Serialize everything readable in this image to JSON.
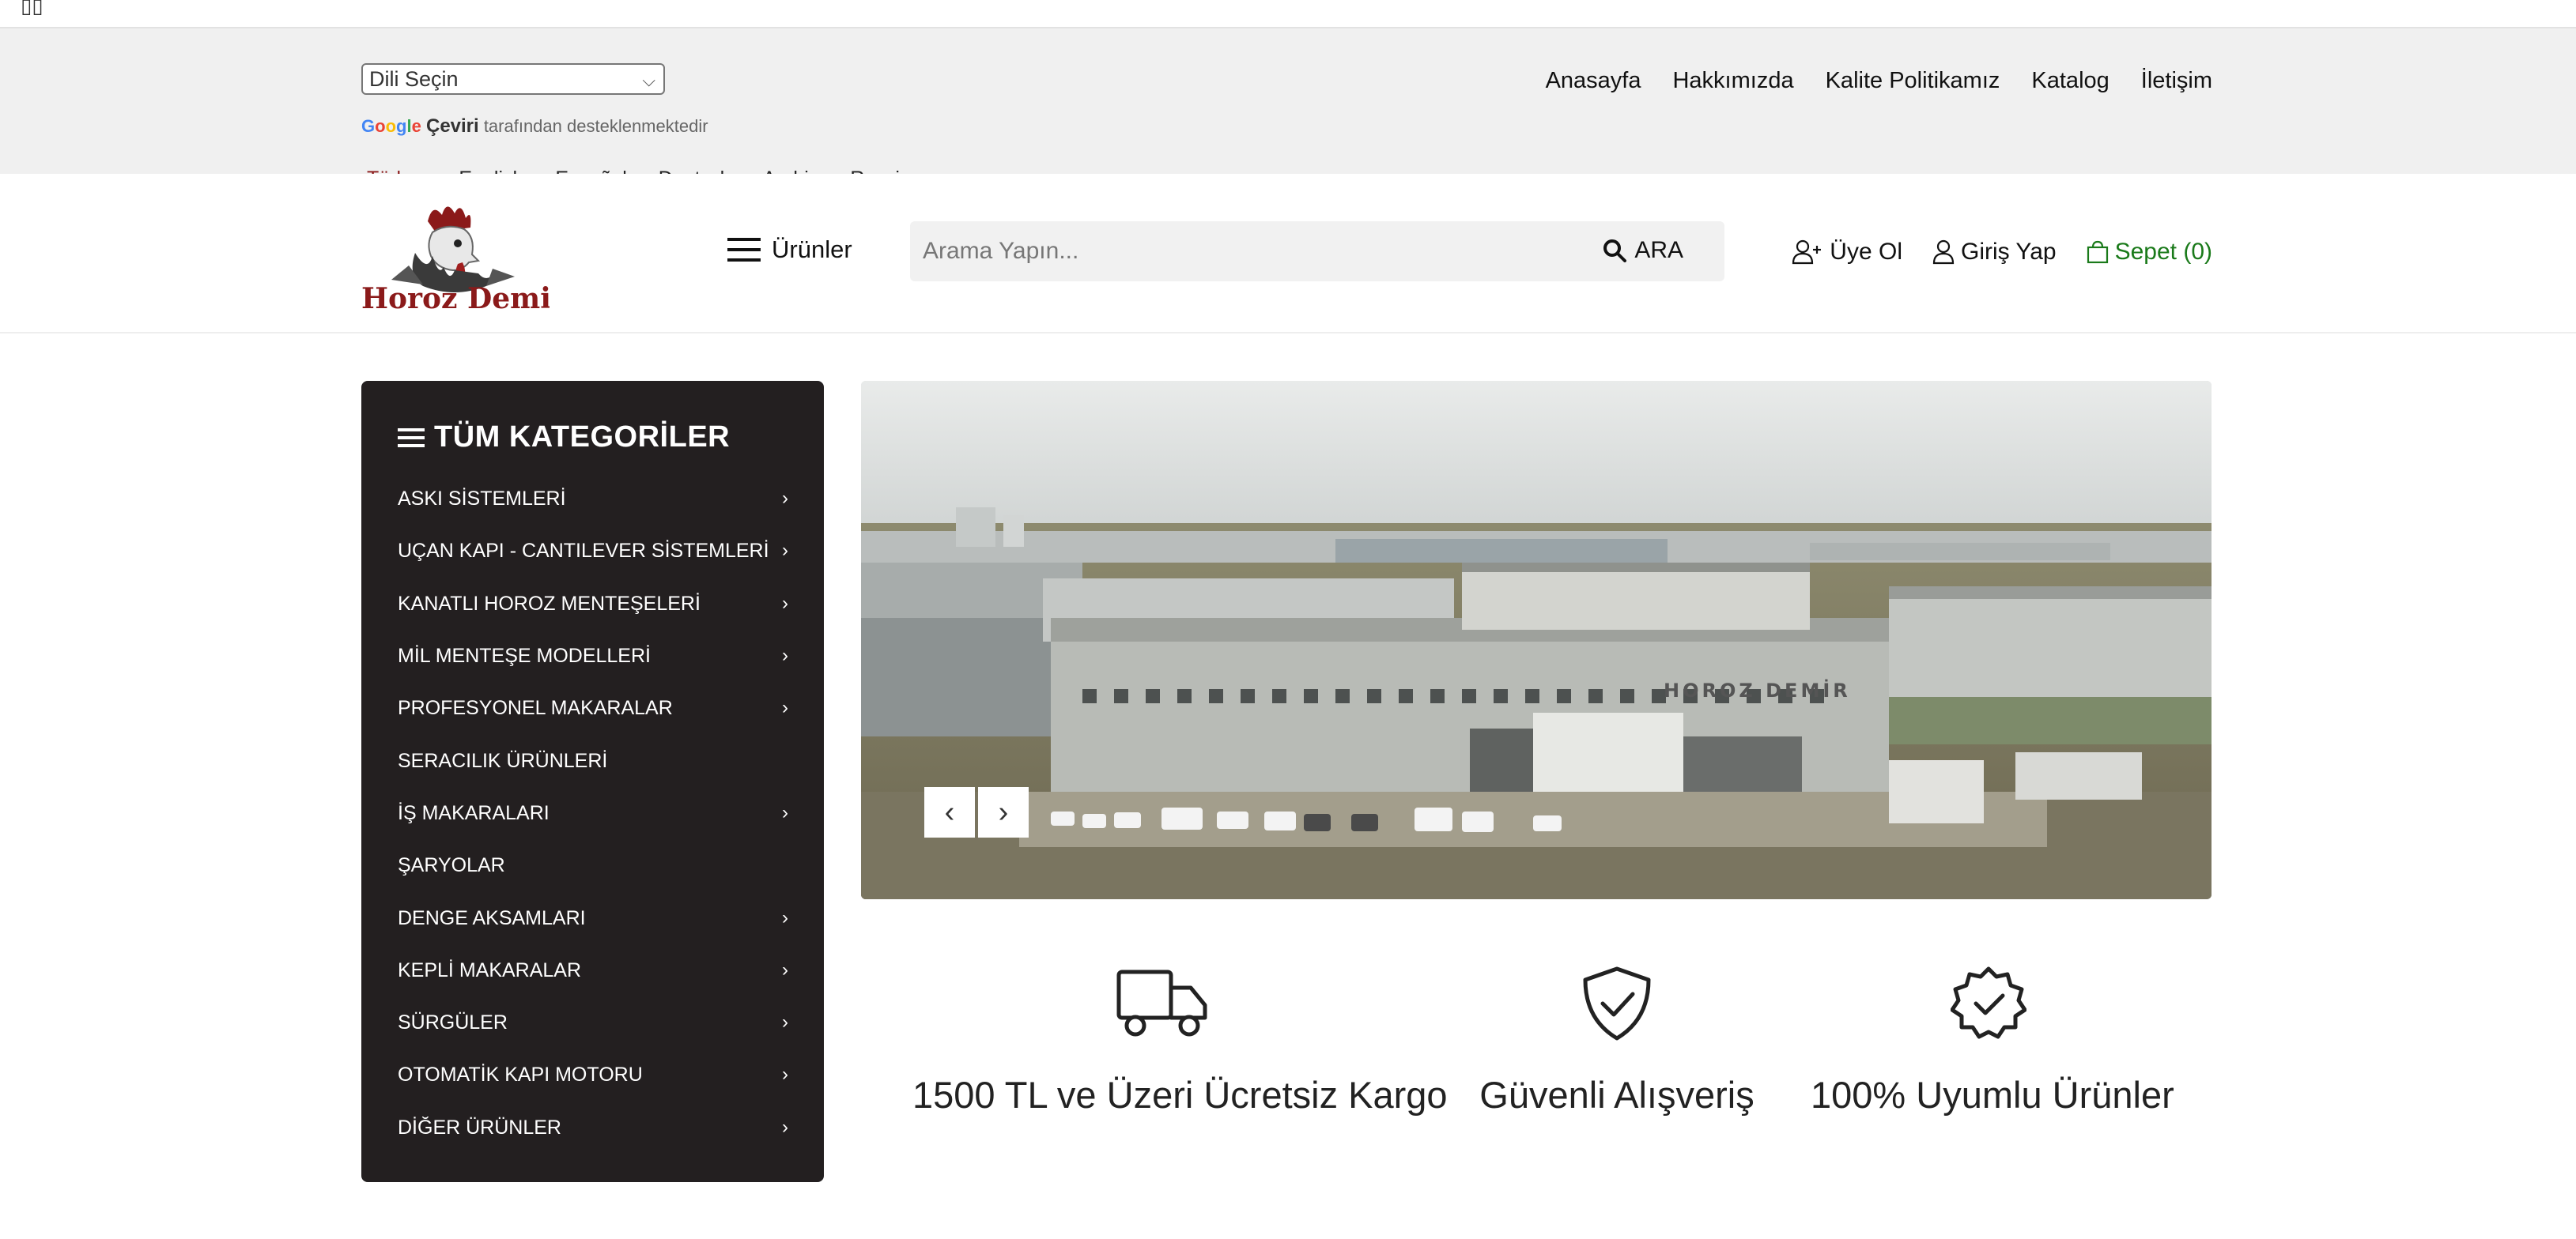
{
  "topbar": {
    "language_select": {
      "value": "Dili Seçin"
    },
    "google_translate": {
      "logo": "Google",
      "brand": "Çeviri",
      "text": "tarafından desteklenmektedir"
    },
    "languages": [
      {
        "label": "Türkçe",
        "active": true
      },
      {
        "label": "English",
        "active": false
      },
      {
        "label": "Español",
        "active": false
      },
      {
        "label": "Deutsch",
        "active": false
      },
      {
        "label": "Arabic",
        "active": false
      },
      {
        "label": "Russian",
        "active": false
      }
    ],
    "nav": [
      "Anasayfa",
      "Hakkımızda",
      "Kalite Politikamız",
      "Katalog",
      "İletişim"
    ]
  },
  "header": {
    "logo_text": "Horoz Demir",
    "menu_label": "Ürünler",
    "search": {
      "placeholder": "Arama Yapın...",
      "button_label": "ARA"
    },
    "register_label": "Üye Ol",
    "login_label": "Giriş Yap",
    "cart_label": "Sepet (0)"
  },
  "categories": {
    "title": "TÜM KATEGORİLER",
    "items": [
      {
        "label": "ASKI SİSTEMLERİ",
        "has_sub": true
      },
      {
        "label": "UÇAN KAPI - CANTILEVER SİSTEMLERİ",
        "has_sub": true
      },
      {
        "label": "KANATLI HOROZ MENTEŞELERİ",
        "has_sub": true
      },
      {
        "label": "MİL MENTEŞE MODELLERİ",
        "has_sub": true
      },
      {
        "label": "PROFESYONEL MAKARALAR",
        "has_sub": true
      },
      {
        "label": "SERACILIK ÜRÜNLERİ",
        "has_sub": false
      },
      {
        "label": "İŞ MAKARALARI",
        "has_sub": true
      },
      {
        "label": "ŞARYOLAR",
        "has_sub": false
      },
      {
        "label": "DENGE AKSAMLARI",
        "has_sub": true
      },
      {
        "label": "KEPLİ MAKARALAR",
        "has_sub": true
      },
      {
        "label": "SÜRGÜLER",
        "has_sub": true
      },
      {
        "label": "OTOMATİK KAPI MOTORU",
        "has_sub": true
      },
      {
        "label": "DİĞER ÜRÜNLER",
        "has_sub": true
      }
    ]
  },
  "slider": {
    "building_sign": "HOROZ DEMİR"
  },
  "features": [
    {
      "icon": "truck-icon",
      "text": "1500 TL ve Üzeri Ücretsiz Kargo"
    },
    {
      "icon": "shield-check-icon",
      "text": "Güvenli Alışveriş"
    },
    {
      "icon": "badge-check-icon",
      "text": "100% Uyumlu Ürünler"
    }
  ],
  "colors": {
    "category_bg": "#231f20",
    "cart": "#1a7a1a",
    "active_lang": "#8b1a1a",
    "logo_red": "#8b1a1a"
  }
}
